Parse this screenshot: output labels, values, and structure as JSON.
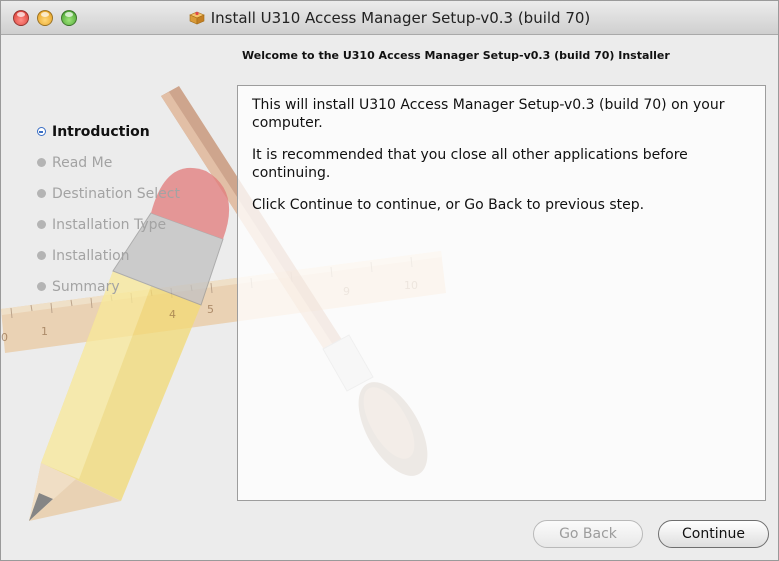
{
  "window": {
    "title": "Install U310 Access Manager Setup-v0.3 (build 70)"
  },
  "heading": "Welcome to the U310 Access Manager Setup-v0.3 (build 70) Installer",
  "steps": [
    {
      "label": "Introduction",
      "active": true
    },
    {
      "label": "Read Me",
      "active": false
    },
    {
      "label": "Destination Select",
      "active": false
    },
    {
      "label": "Installation Type",
      "active": false
    },
    {
      "label": "Installation",
      "active": false
    },
    {
      "label": "Summary",
      "active": false
    }
  ],
  "content": {
    "paragraphs": [
      "This will install U310 Access Manager Setup-v0.3 (build 70) on your computer.",
      "It is recommended that you close all other applications before continuing.",
      "Click Continue to continue, or Go Back to previous step."
    ]
  },
  "buttons": {
    "go_back": "Go Back",
    "continue": "Continue"
  },
  "colors": {
    "active_step_bullet": "#3b6fc4",
    "window_bg": "#ececec"
  }
}
